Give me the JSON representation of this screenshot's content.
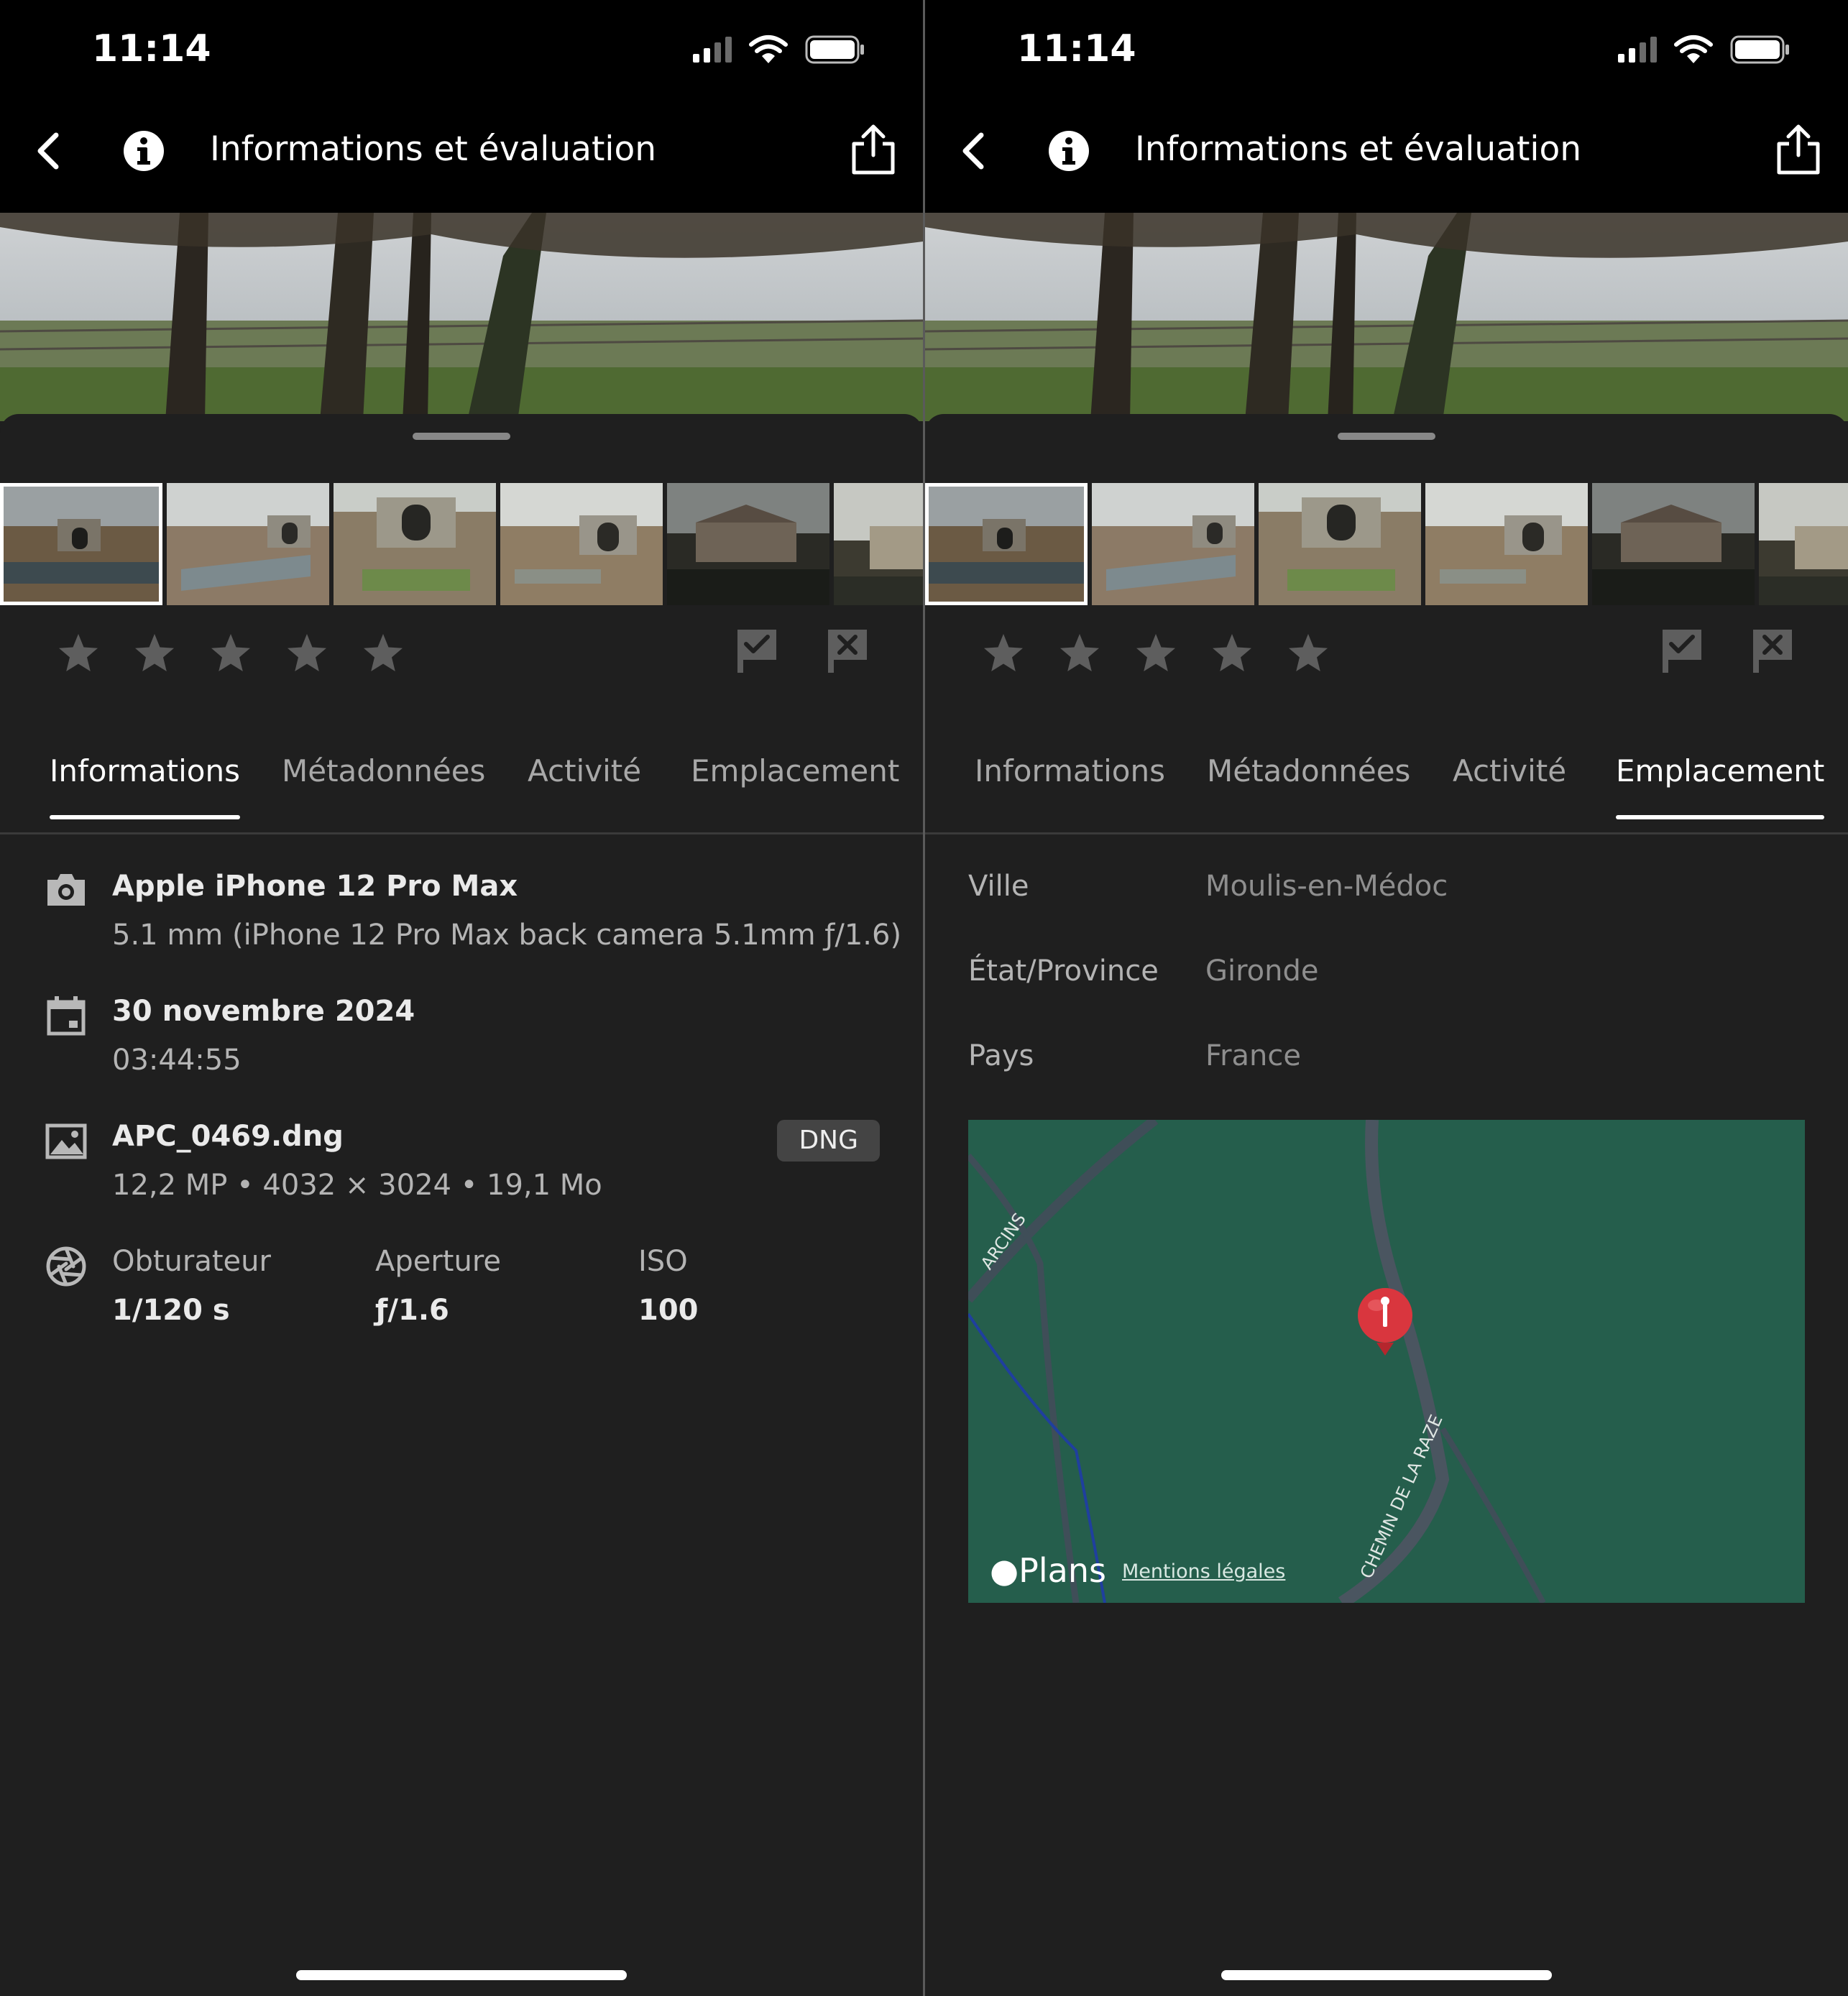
{
  "status": {
    "time": "11:14"
  },
  "nav": {
    "title": "Informations et évaluation"
  },
  "icons": {
    "back": "chevron-left-icon",
    "info": "info-icon",
    "share": "share-icon",
    "star": "star-icon",
    "pick": "flag-pick-icon",
    "reject": "flag-reject-icon"
  },
  "tabs": [
    {
      "label": "Informations"
    },
    {
      "label": "Métadonnées"
    },
    {
      "label": "Activité"
    },
    {
      "label": "Emplacement"
    }
  ],
  "rating": {
    "stars": 0,
    "max": 5
  },
  "info": {
    "camera_model": "Apple iPhone 12 Pro Max",
    "lens": "5.1 mm (iPhone 12 Pro Max back camera 5.1mm ƒ/1.6)",
    "date": "30 novembre 2024",
    "time": "03:44:55",
    "filename": "APC_0469.dng",
    "badge": "DNG",
    "file_details": "12,2 MP • 4032 × 3024 • 19,1 Mo",
    "exposure": [
      {
        "label": "Obturateur",
        "value": "1/120 s"
      },
      {
        "label": "Aperture",
        "value": "ƒ/1.6"
      },
      {
        "label": "ISO",
        "value": "100"
      }
    ]
  },
  "location": {
    "rows": [
      {
        "label": "Ville",
        "value": "Moulis-en-Médoc"
      },
      {
        "label": "État/Province",
        "value": "Gironde"
      },
      {
        "label": "Pays",
        "value": "France"
      }
    ],
    "map": {
      "logo": "Plans",
      "legal": "Mentions légales",
      "road_labels": [
        "ARCINS",
        "CHEMIN DE LA RAZE"
      ],
      "pin_color": "#d9363e",
      "water_color": "#1f3f9e",
      "land_color": "#255e4c"
    }
  }
}
